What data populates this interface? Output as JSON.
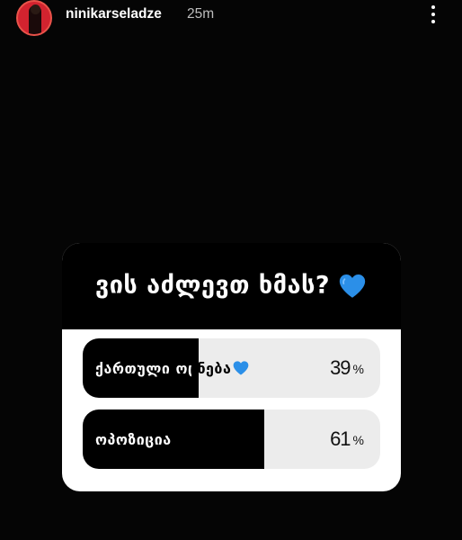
{
  "story": {
    "username": "ninikarseladze",
    "time": "25m"
  },
  "poll": {
    "question": "ვის აძლევთ ხმას?",
    "options": [
      {
        "label": "ქართული ოცნება",
        "percent": 39,
        "percent_text": "39",
        "suffix": "%"
      },
      {
        "label": "ოპოზიცია",
        "percent": 61,
        "percent_text": "61",
        "suffix": "%"
      }
    ]
  },
  "colors": {
    "background": "#050505",
    "poll_header": "#000000",
    "poll_bar_fill": "#000000",
    "poll_bar_track": "#ececec",
    "avatar_ring": "#e9534a",
    "heart": "#2b8fe8"
  },
  "icons": [
    "more-vertical-icon",
    "blue-heart-icon"
  ]
}
